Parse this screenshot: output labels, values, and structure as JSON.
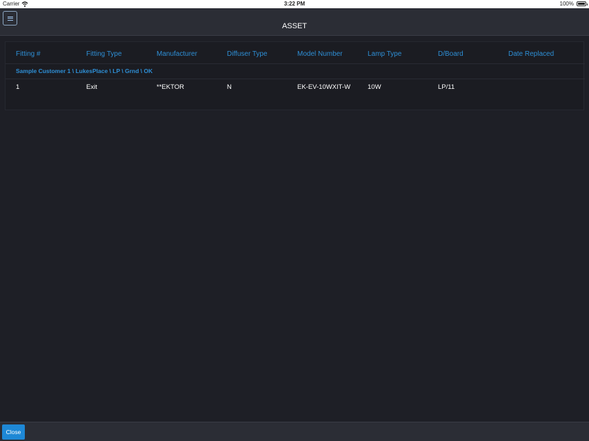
{
  "status_bar": {
    "carrier": "Carrier",
    "time": "3:22 PM",
    "battery": "100%",
    "battery_level": 1.0
  },
  "nav": {
    "title": "ASSET",
    "menu_icon": "hamburger-menu-icon"
  },
  "table": {
    "columns": [
      "Fitting #",
      "Fitting Type",
      "Manufacturer",
      "Diffuser Type",
      "Model Number",
      "Lamp Type",
      "D/Board",
      "Date Replaced"
    ],
    "group_label": "Sample Customer 1 \\ LukesPlace \\ LP \\ Grnd \\ OK",
    "rows": [
      {
        "fitting_no": "1",
        "fitting_type": "Exit",
        "manufacturer": "**EKTOR",
        "diffuser_type": "N",
        "model_number": "EK-EV-10WXIT-W",
        "lamp_type": "10W",
        "dboard": "LP/11",
        "date_replaced": ""
      }
    ]
  },
  "footer": {
    "close_label": "Close"
  },
  "colors": {
    "background": "#1e1f26",
    "accent": "#2e8fd6",
    "button": "#1e88d6"
  }
}
